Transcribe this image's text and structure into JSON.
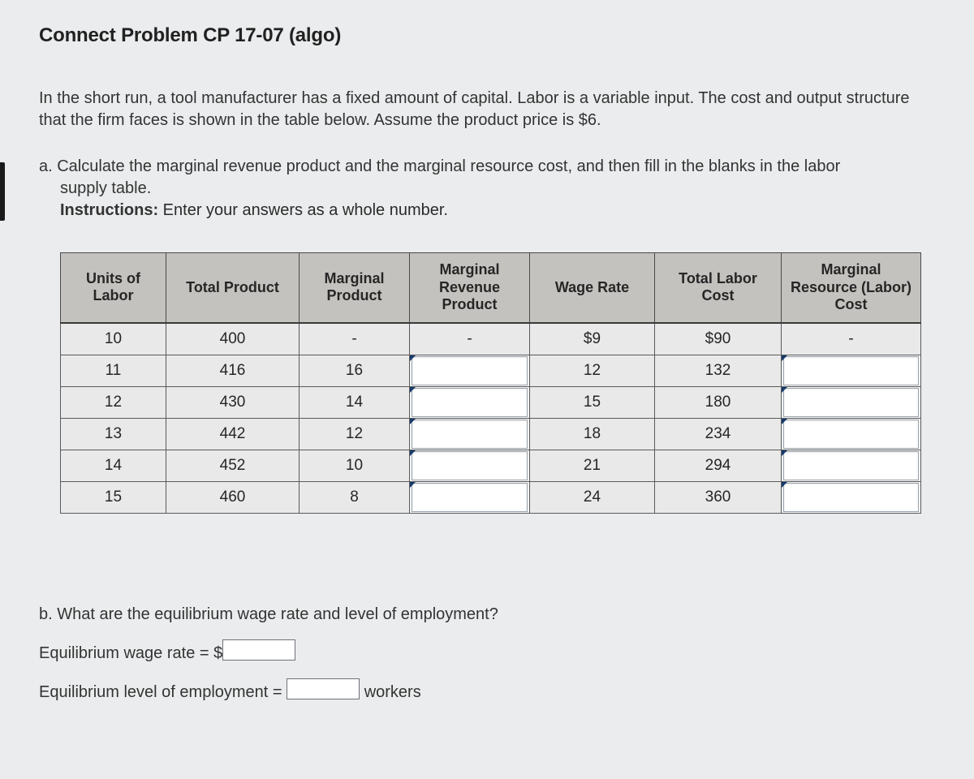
{
  "title": "Connect Problem CP 17-07 (algo)",
  "intro": "In the short run, a tool manufacturer has a fixed amount of capital. Labor is a variable input. The cost and output structure that the firm faces is shown in the table below. Assume the product price is $6.",
  "part_a": {
    "lead": "a. Calculate the marginal revenue product and the marginal resource cost, and then fill in the blanks in the labor",
    "cont": "supply table.",
    "instructions_label": "Instructions:",
    "instructions_text": " Enter your answers as a whole number."
  },
  "table": {
    "headers": [
      "Units of Labor",
      "Total Product",
      "Marginal Product",
      "Marginal Revenue Product",
      "Wage Rate",
      "Total Labor Cost",
      "Marginal Resource (Labor) Cost"
    ],
    "rows": [
      {
        "units": "10",
        "tp": "400",
        "mp": "-",
        "mrp": "-",
        "wage": "$9",
        "tlc": "$90",
        "mrc": "-",
        "mrp_input": false,
        "mrc_input": false
      },
      {
        "units": "11",
        "tp": "416",
        "mp": "16",
        "mrp": "",
        "wage": "12",
        "tlc": "132",
        "mrc": "",
        "mrp_input": true,
        "mrc_input": true
      },
      {
        "units": "12",
        "tp": "430",
        "mp": "14",
        "mrp": "",
        "wage": "15",
        "tlc": "180",
        "mrc": "",
        "mrp_input": true,
        "mrc_input": true
      },
      {
        "units": "13",
        "tp": "442",
        "mp": "12",
        "mrp": "",
        "wage": "18",
        "tlc": "234",
        "mrc": "",
        "mrp_input": true,
        "mrc_input": true
      },
      {
        "units": "14",
        "tp": "452",
        "mp": "10",
        "mrp": "",
        "wage": "21",
        "tlc": "294",
        "mrc": "",
        "mrp_input": true,
        "mrc_input": true
      },
      {
        "units": "15",
        "tp": "460",
        "mp": "8",
        "mrp": "",
        "wage": "24",
        "tlc": "360",
        "mrc": "",
        "mrp_input": true,
        "mrc_input": true
      }
    ]
  },
  "part_b": {
    "question": "b. What are the equilibrium wage rate and level of employment?",
    "wage_label": "Equilibrium wage rate = $",
    "employment_label_pre": "Equilibrium level of employment = ",
    "employment_label_post": " workers"
  }
}
